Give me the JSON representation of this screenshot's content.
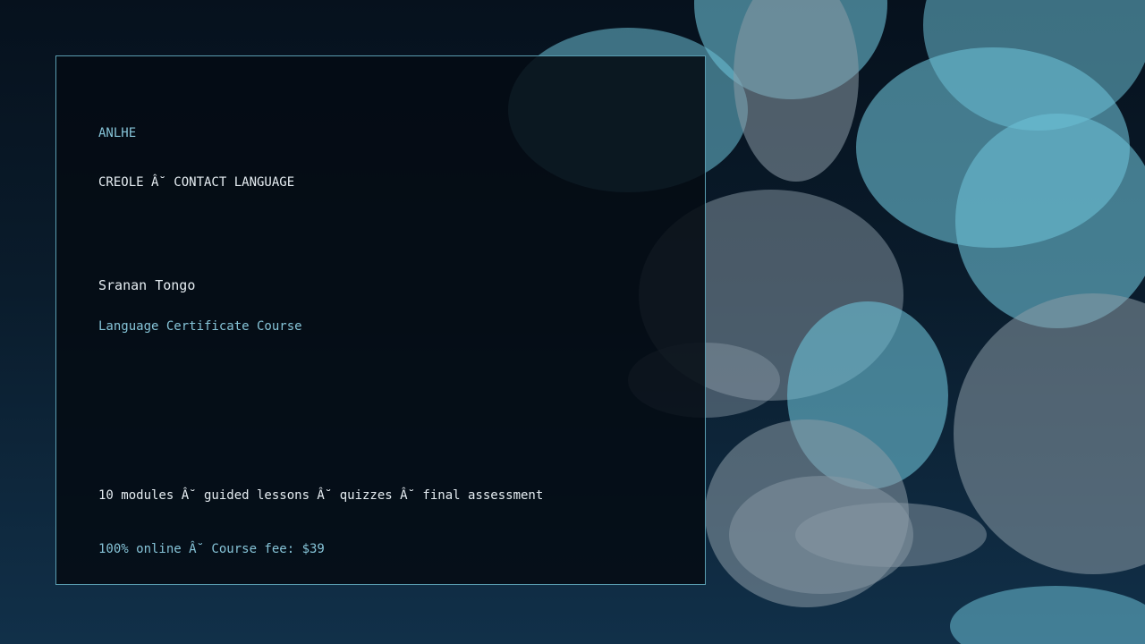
{
  "slide": {
    "brand": "ANLHE",
    "category": "CREOLE Â˘ CONTACT LANGUAGE",
    "language": "Sranan Tongo",
    "subtitle": "Language Certificate Course",
    "details": "10 modules Â˘ guided lessons Â˘ quizzes Â˘ final assessment",
    "pricing": "100% online Â˘ Course fee: $39"
  },
  "colors": {
    "background_top": "#06111d",
    "background_bottom": "#113049",
    "panel_border": "#5a9db0",
    "accent_text": "#86c4d8",
    "primary_text": "#e6edf2",
    "bubble_teal": "#6cbfd6",
    "bubble_grey": "#8a9aa6"
  }
}
